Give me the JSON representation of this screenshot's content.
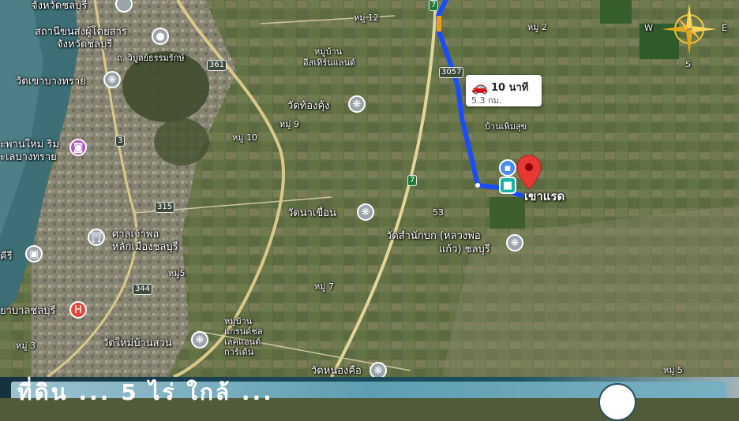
{
  "map": {
    "places": {
      "chonburi_province": "จังหวัดชลบุรี",
      "bus_terminal_l1": "สถานีขนส่งผู้โดยสาร",
      "bus_terminal_l2": "จังหวัดชลบุรี",
      "road_sukhumvit_arch": "ถ. วิบูลย์ธรรมรักษ์",
      "wat_khao_bang_sai": "วัดเขาบางทราย",
      "saphan_mai_l1": "ะพานใหม่ ริม",
      "saphan_mai_l2": "ะเลบางทราย",
      "moo_12": "หมู่ 12",
      "moo_2": "หมู่ 2",
      "eastern_land_l1": "หมู่บ้าน",
      "eastern_land_l2": "อีสเทิร์นแลนด์",
      "wat_thong_khung": "วัดท้องคุ้ง",
      "moo_9": "หมู่ 9",
      "moo_10": "หมู่ 10",
      "ban_phoem_suk": "บ้านเพิ่มสุข",
      "khao_raet": "เขาแรด",
      "wat_na_khuean": "วัดนาเขื่อน",
      "wat_samnak_bok_l1": "วัดสำนักบก (หลวงพ่อ",
      "wat_samnak_bok_l2": "แก้ว) ชลบุรี",
      "city_pillar_l1": "ศาลเจ้าพ่อ",
      "city_pillar_l2": "หลักเมืองชลบุรี",
      "khiri": "คีรี",
      "moo_5_left": "หมู่5",
      "moo_7": "หมู่ 7",
      "hospital": "ยาบาลชลบุรี",
      "moo_3": "หมู่ 3",
      "village_grand_l1": "หมู่บ้าน",
      "village_grand_l2": "แกรนด์ชล",
      "village_grand_l3": "เลคแอนด์",
      "village_grand_l4": "การ์เด้น",
      "wat_mai_ban_suan": "วัดใหม่บ้านสวน",
      "wat_nong_kho": "วัดหนองคือ",
      "moo_5_right": "หมู่ 5",
      "road_53": "53"
    },
    "shields": {
      "r361": "361",
      "r3057": "3057",
      "r3": "3",
      "r7": "7",
      "r315": "315",
      "r344": "344"
    },
    "route": {
      "duration": "10 นาที",
      "distance": "5.3 กม.",
      "route_color": "#1a4dff",
      "pin_color": "#e53935"
    },
    "compass": {
      "west": "W",
      "east": "E",
      "south": "S"
    }
  },
  "banner": {
    "text": "ที่ดิน ... 5 ไร่ ใกล้ ..."
  }
}
